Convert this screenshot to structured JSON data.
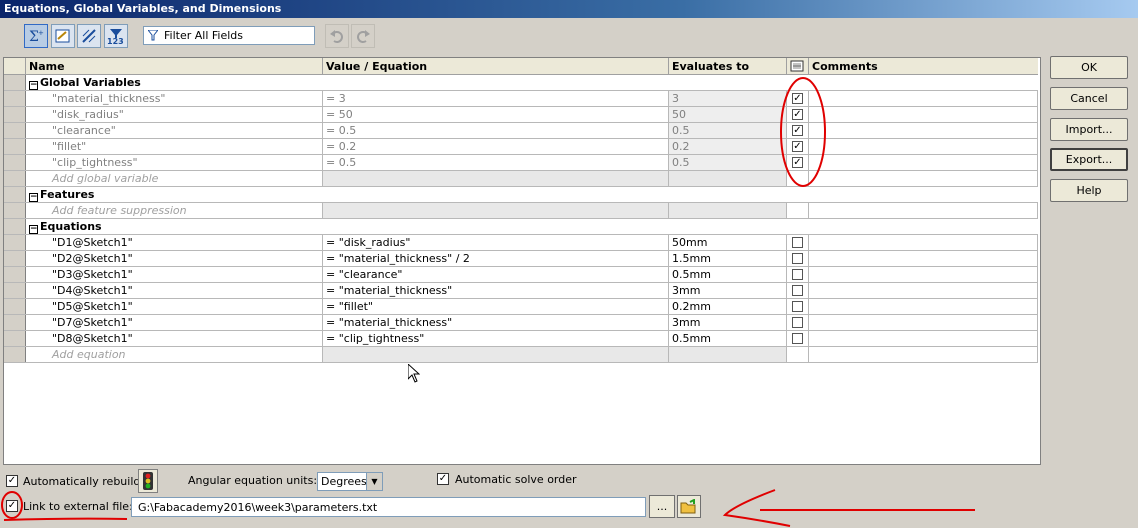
{
  "window": {
    "title": "Equations, Global Variables, and Dimensions"
  },
  "toolbar": {
    "buttons": [
      "equation-view-icon",
      "sketch-equation-view-icon",
      "dimension-view-icon",
      "ordered-view-icon"
    ],
    "filter_placeholder": "Filter All Fields",
    "undo_icon": "undo-icon",
    "redo_icon": "redo-icon"
  },
  "table": {
    "headers": {
      "name": "Name",
      "value": "Value / Equation",
      "evaluates": "Evaluates to",
      "comments": "Comments"
    },
    "global_section": "Global Variables",
    "global_vars": [
      {
        "name": "\"material_thickness\"",
        "value": "= 3",
        "evaluates": "3",
        "checked": true
      },
      {
        "name": "\"disk_radius\"",
        "value": "= 50",
        "evaluates": "50",
        "checked": true
      },
      {
        "name": "\"clearance\"",
        "value": "= 0.5",
        "evaluates": "0.5",
        "checked": true
      },
      {
        "name": "\"fillet\"",
        "value": "= 0.2",
        "evaluates": "0.2",
        "checked": true
      },
      {
        "name": "\"clip_tightness\"",
        "value": "= 0.5",
        "evaluates": "0.5",
        "checked": true
      }
    ],
    "add_global": "Add global variable",
    "features_section": "Features",
    "add_feature": "Add feature suppression",
    "equations_section": "Equations",
    "equations": [
      {
        "name": "\"D1@Sketch1\"",
        "value": "= \"disk_radius\"",
        "evaluates": "50mm",
        "checked": false
      },
      {
        "name": "\"D2@Sketch1\"",
        "value": "= \"material_thickness\" / 2",
        "evaluates": "1.5mm",
        "checked": false
      },
      {
        "name": "\"D3@Sketch1\"",
        "value": "= \"clearance\"",
        "evaluates": "0.5mm",
        "checked": false
      },
      {
        "name": "\"D4@Sketch1\"",
        "value": "= \"material_thickness\"",
        "evaluates": "3mm",
        "checked": false
      },
      {
        "name": "\"D5@Sketch1\"",
        "value": "= \"fillet\"",
        "evaluates": "0.2mm",
        "checked": false
      },
      {
        "name": "\"D7@Sketch1\"",
        "value": "= \"material_thickness\"",
        "evaluates": "3mm",
        "checked": false
      },
      {
        "name": "\"D8@Sketch1\"",
        "value": "= \"clip_tightness\"",
        "evaluates": "0.5mm",
        "checked": false
      }
    ],
    "add_equation": "Add equation"
  },
  "buttons": {
    "ok": "OK",
    "cancel": "Cancel",
    "import": "Import...",
    "export": "Export...",
    "help": "Help"
  },
  "bottom": {
    "auto_rebuild": "Automatically rebuild",
    "auto_rebuild_checked": true,
    "angular_units_label": "Angular equation units:",
    "angular_units_value": "Degrees",
    "auto_solve": "Automatic solve order",
    "auto_solve_checked": true,
    "link_external": "Link to external file:",
    "link_external_checked": true,
    "file_path": "G:\\Fabacademy2016\\week3\\parameters.txt",
    "browse": "..."
  },
  "colors": {
    "annotation": "#e00000",
    "title_bar": "#0a246a"
  }
}
